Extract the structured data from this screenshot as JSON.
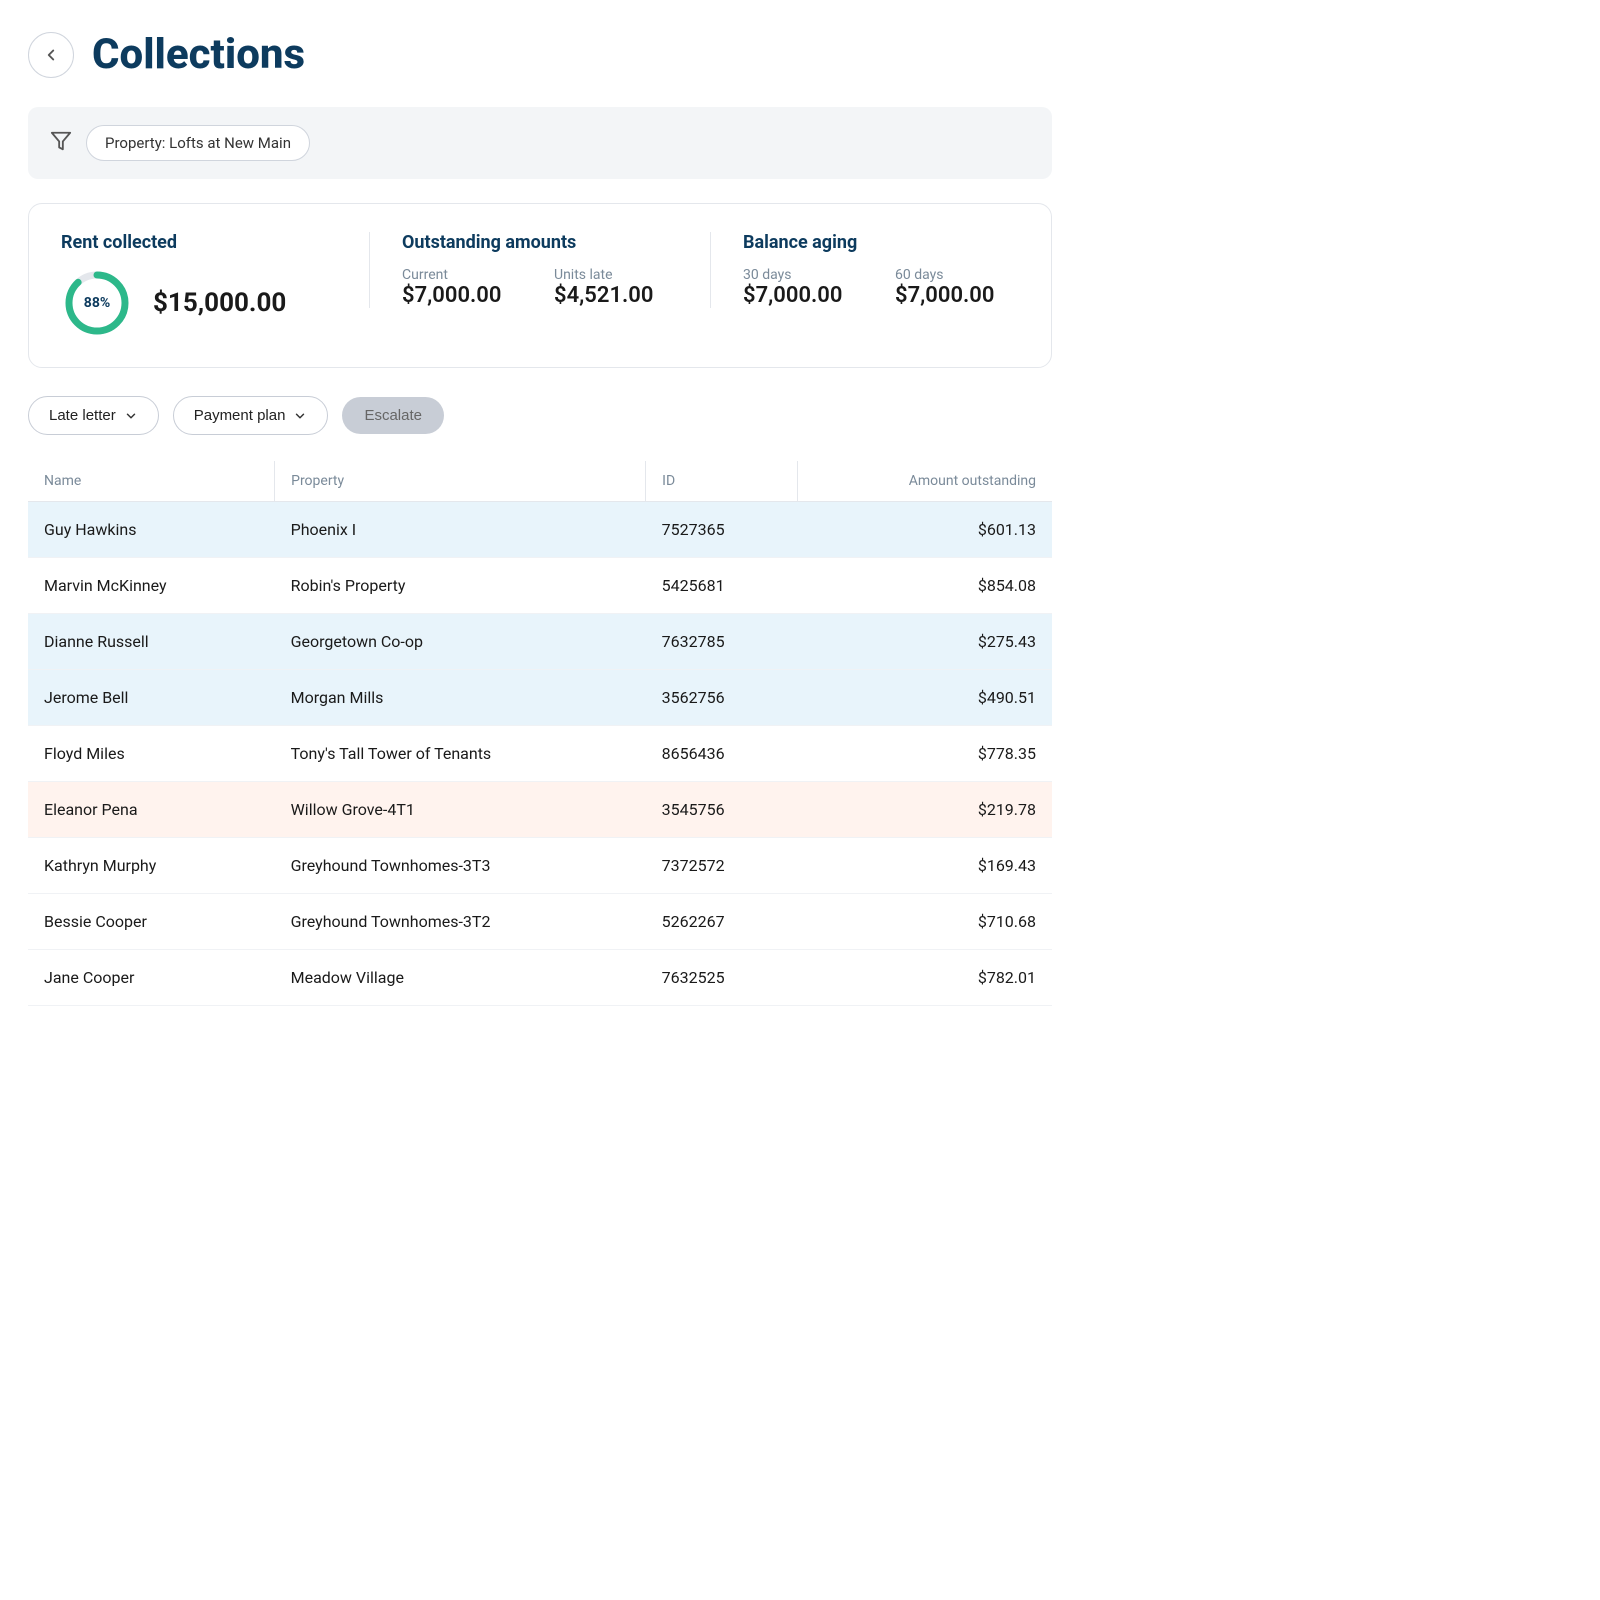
{
  "header": {
    "title": "Collections",
    "back_label": "back"
  },
  "filter": {
    "icon": "funnel",
    "tag": "Property: Lofts at New Main"
  },
  "stats": {
    "rent_collected": {
      "label": "Rent collected",
      "percent": 88,
      "amount": "$15,000.00"
    },
    "outstanding_amounts": {
      "label": "Outstanding amounts",
      "current_label": "Current",
      "current_value": "$7,000.00",
      "units_late_label": "Units late",
      "units_late_value": "$4,521.00"
    },
    "balance_aging": {
      "label": "Balance aging",
      "thirty_days_label": "30 days",
      "thirty_days_value": "$7,000.00",
      "sixty_days_label": "60 days",
      "sixty_days_value": "$7,000.00"
    }
  },
  "actions": {
    "late_letter": "Late letter",
    "payment_plan": "Payment plan",
    "escalate": "Escalate"
  },
  "table": {
    "columns": [
      "Name",
      "Property",
      "ID",
      "Amount outstanding"
    ],
    "rows": [
      {
        "name": "Guy Hawkins",
        "property": "Phoenix I",
        "id": "7527365",
        "amount": "$601.13",
        "style": "blue"
      },
      {
        "name": "Marvin McKinney",
        "property": "Robin's Property",
        "id": "5425681",
        "amount": "$854.08",
        "style": "white"
      },
      {
        "name": "Dianne Russell",
        "property": "Georgetown Co-op",
        "id": "7632785",
        "amount": "$275.43",
        "style": "blue"
      },
      {
        "name": "Jerome Bell",
        "property": "Morgan Mills",
        "id": "3562756",
        "amount": "$490.51",
        "style": "blue"
      },
      {
        "name": "Floyd Miles",
        "property": "Tony's Tall Tower of Tenants",
        "id": "8656436",
        "amount": "$778.35",
        "style": "white"
      },
      {
        "name": "Eleanor Pena",
        "property": "Willow Grove-4T1",
        "id": "3545756",
        "amount": "$219.78",
        "style": "peach"
      },
      {
        "name": "Kathryn Murphy",
        "property": "Greyhound Townhomes-3T3",
        "id": "7372572",
        "amount": "$169.43",
        "style": "white"
      },
      {
        "name": "Bessie Cooper",
        "property": "Greyhound Townhomes-3T2",
        "id": "5262267",
        "amount": "$710.68",
        "style": "white"
      },
      {
        "name": "Jane Cooper",
        "property": "Meadow Village",
        "id": "7632525",
        "amount": "$782.01",
        "style": "white"
      }
    ]
  }
}
